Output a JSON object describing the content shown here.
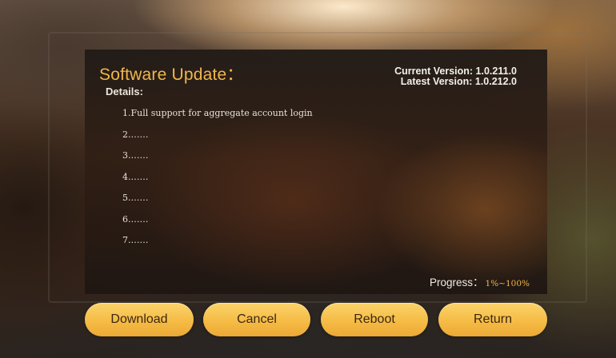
{
  "update": {
    "title": "Software Update：",
    "details_label": "Details:",
    "current_version": "Current Version: 1.0.211.0",
    "latest_version": "Latest Version: 1.0.212.0",
    "details": [
      "1.Full support for aggregate account login",
      "2.……",
      "3.……",
      "4.……",
      "5.……",
      "6.……",
      "7.……"
    ],
    "progress_label": "Progress：",
    "progress_value": "1%~100%"
  },
  "buttons": {
    "download": "Download",
    "cancel": "Cancel",
    "reboot": "Reboot",
    "return": "Return"
  },
  "colors": {
    "accent": "#f5bc45",
    "title": "#f2b64a",
    "button_text": "#3b2612"
  }
}
